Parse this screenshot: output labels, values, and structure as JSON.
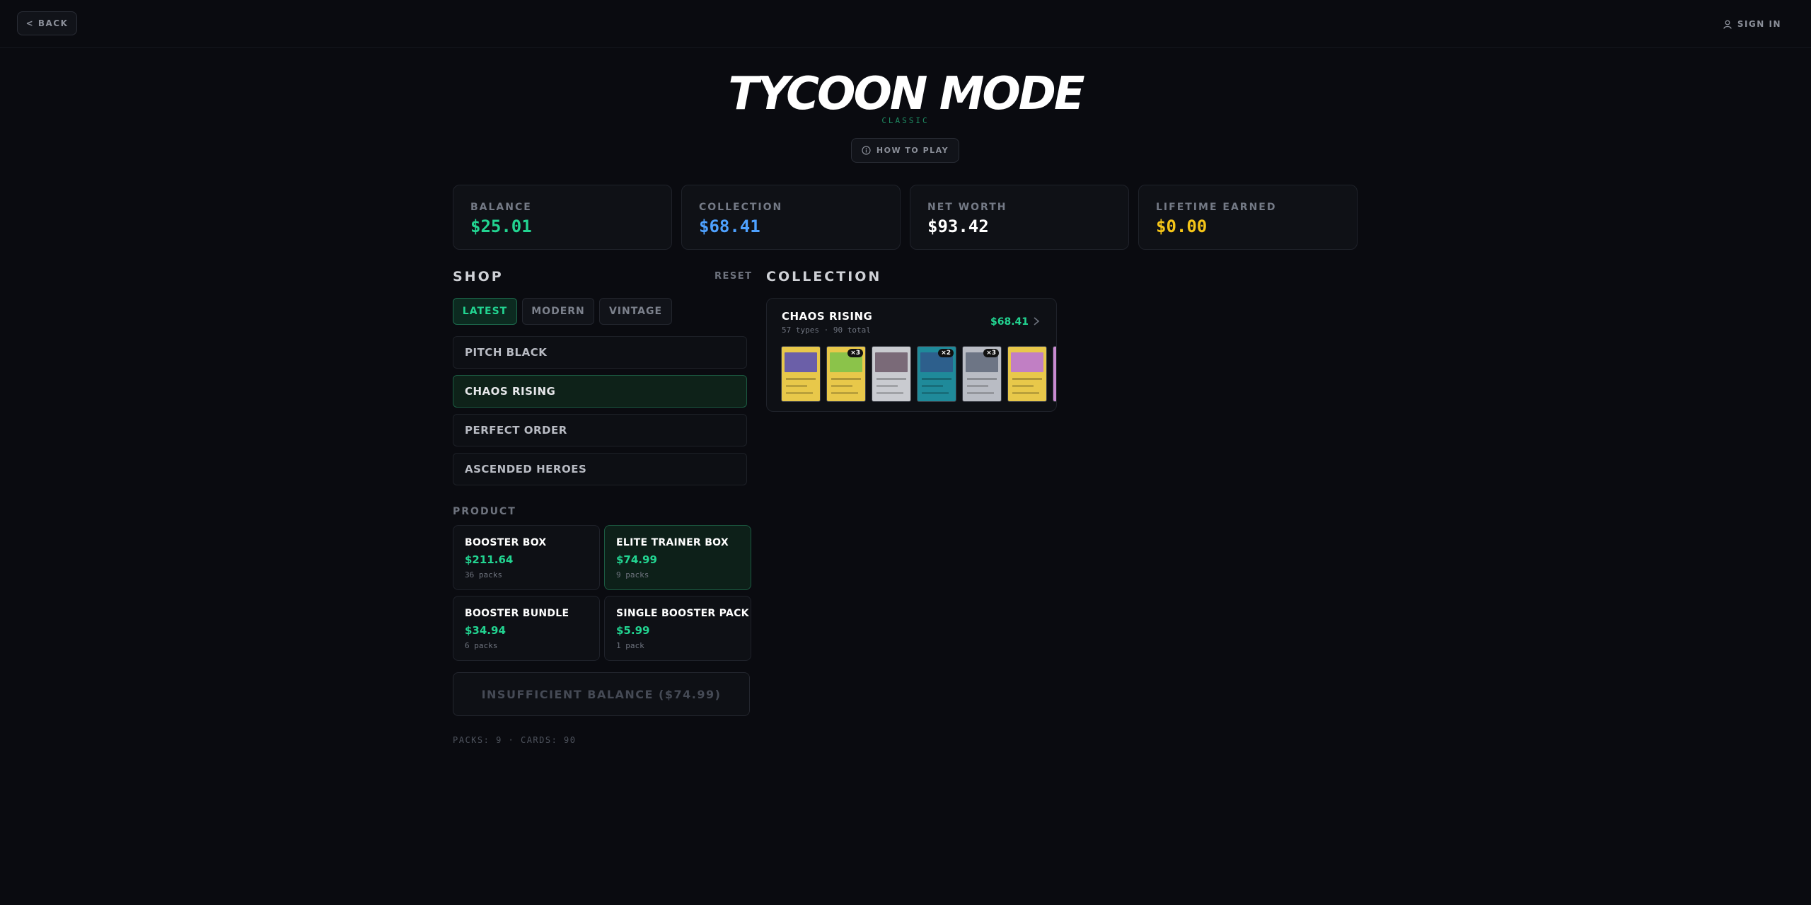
{
  "topbar": {
    "back_label": "< BACK",
    "signin_label": "SIGN IN",
    "user_icon": "user-icon"
  },
  "header": {
    "title": "TYCOON MODE",
    "subtitle": "CLASSIC",
    "howto_label": "HOW TO PLAY",
    "howto_icon": "info-icon"
  },
  "stats": [
    {
      "label": "BALANCE",
      "value": "$25.01",
      "color": "#22d491"
    },
    {
      "label": "COLLECTION",
      "value": "$68.41",
      "color": "#4ea1ff"
    },
    {
      "label": "NET WORTH",
      "value": "$93.42",
      "color": "#ffffff"
    },
    {
      "label": "LIFETIME EARNED",
      "value": "$0.00",
      "color": "#f5c518"
    }
  ],
  "shop": {
    "title": "SHOP",
    "reset_label": "RESET",
    "tabs": [
      {
        "label": "LATEST",
        "active": true
      },
      {
        "label": "MODERN",
        "active": false
      },
      {
        "label": "VINTAGE",
        "active": false
      }
    ],
    "sets": [
      {
        "label": "PITCH BLACK",
        "active": false
      },
      {
        "label": "CHAOS RISING",
        "active": true
      },
      {
        "label": "PERFECT ORDER",
        "active": false
      },
      {
        "label": "ASCENDED HEROES",
        "active": false
      }
    ],
    "product_label": "PRODUCT",
    "products": [
      {
        "name": "BOOSTER BOX",
        "price": "$211.64",
        "packs": "36 packs",
        "active": false
      },
      {
        "name": "ELITE TRAINER BOX",
        "price": "$74.99",
        "packs": "9 packs",
        "active": true
      },
      {
        "name": "BOOSTER BUNDLE",
        "price": "$34.94",
        "packs": "6 packs",
        "active": false
      },
      {
        "name": "SINGLE BOOSTER PACK",
        "price": "$5.99",
        "packs": "1 pack",
        "active": false
      }
    ],
    "buy_label": "INSUFFICIENT BALANCE ($74.99)",
    "footer": "PACKS: 9  ·  CARDS: 90"
  },
  "collection": {
    "title": "COLLECTION",
    "set_name": "CHAOS RISING",
    "meta": "57 types · 90 total",
    "value": "$68.41",
    "chevron_icon": "chevron-right-icon",
    "cards": [
      {
        "frame": "#e8c84a",
        "art": "#6b5fa8",
        "badge": ""
      },
      {
        "frame": "#e8c84a",
        "art": "#8bc34a",
        "badge": "×3"
      },
      {
        "frame": "#c9cbd0",
        "art": "#7a6a78",
        "badge": ""
      },
      {
        "frame": "#1f8a9a",
        "art": "#2d5f8c",
        "badge": "×2"
      },
      {
        "frame": "#b9bcc4",
        "art": "#6d7585",
        "badge": "×3"
      },
      {
        "frame": "#e8c84a",
        "art": "#c17fc4",
        "badge": ""
      },
      {
        "frame": "#c98ad1",
        "art": "#d4a0d8",
        "badge": ""
      }
    ]
  }
}
